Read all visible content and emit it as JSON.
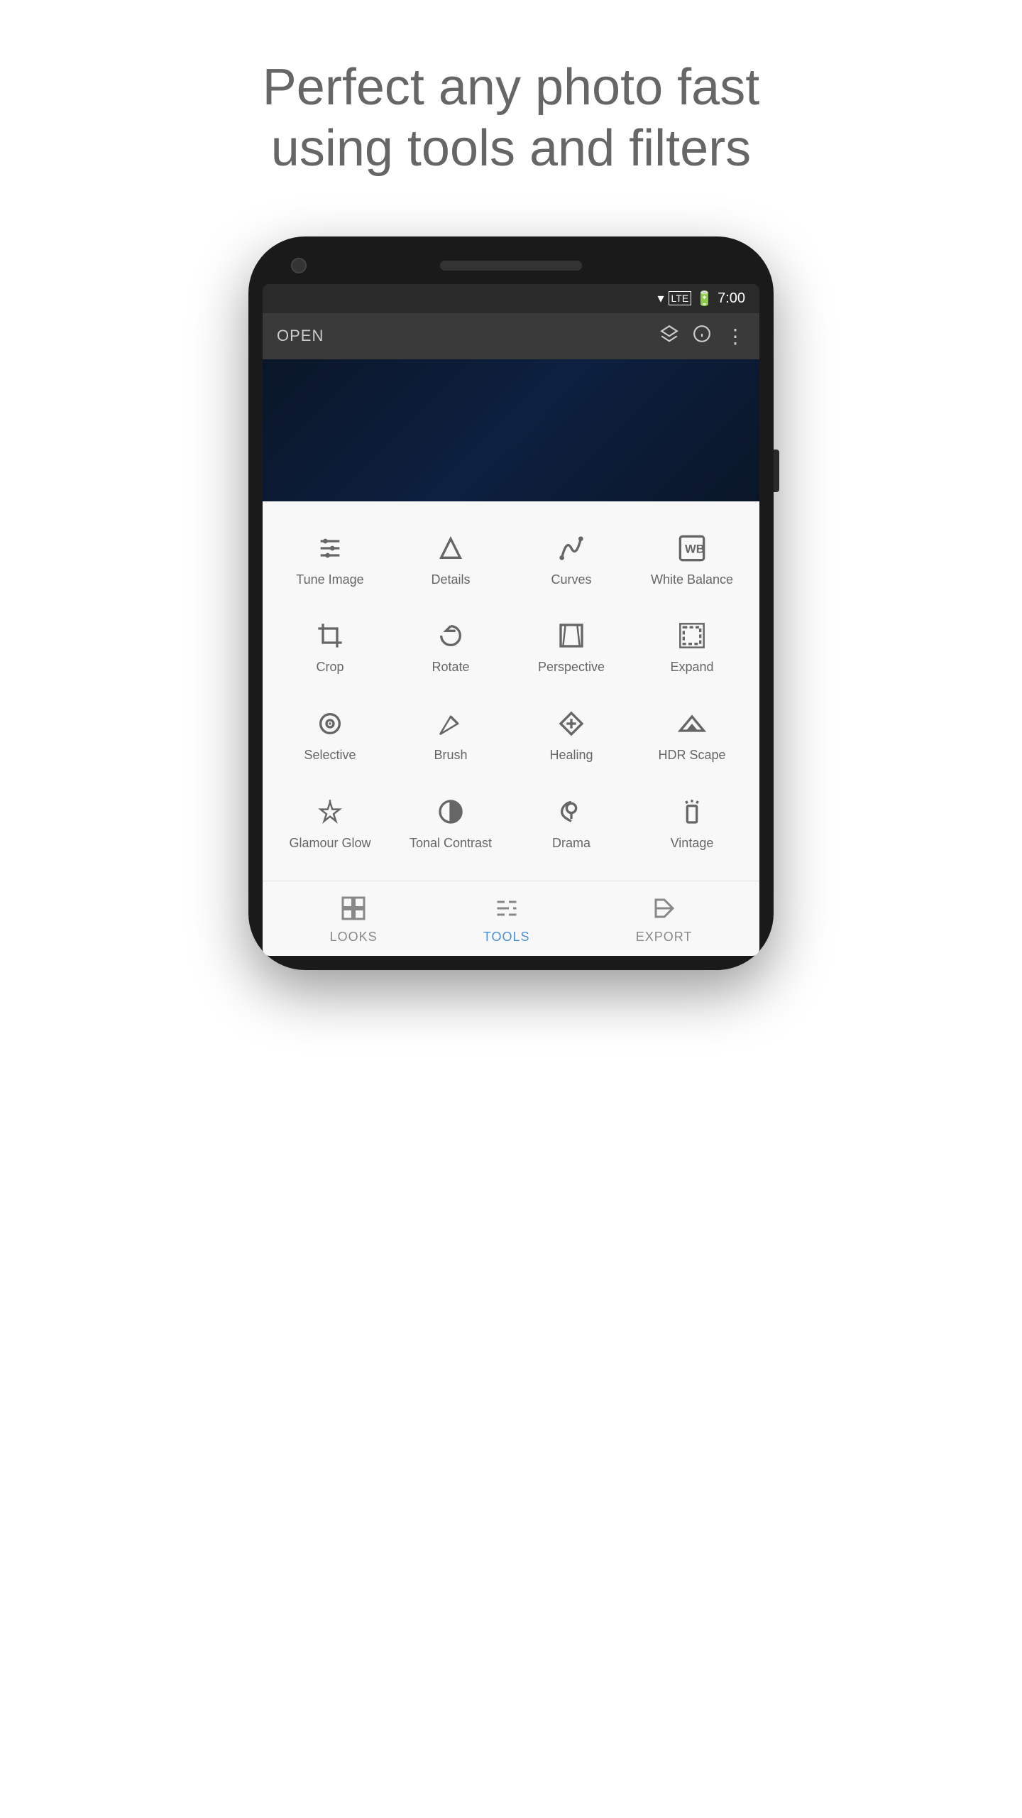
{
  "headline": {
    "line1": "Perfect any photo fast",
    "line2": "using tools and filters"
  },
  "statusBar": {
    "time": "7:00"
  },
  "toolbar": {
    "openLabel": "OPEN"
  },
  "tools": [
    {
      "id": "tune-image",
      "label": "Tune Image",
      "icon": "tune"
    },
    {
      "id": "details",
      "label": "Details",
      "icon": "details"
    },
    {
      "id": "curves",
      "label": "Curves",
      "icon": "curves"
    },
    {
      "id": "white-balance",
      "label": "White Balance",
      "icon": "wb"
    },
    {
      "id": "crop",
      "label": "Crop",
      "icon": "crop"
    },
    {
      "id": "rotate",
      "label": "Rotate",
      "icon": "rotate"
    },
    {
      "id": "perspective",
      "label": "Perspective",
      "icon": "perspective"
    },
    {
      "id": "expand",
      "label": "Expand",
      "icon": "expand"
    },
    {
      "id": "selective",
      "label": "Selective",
      "icon": "selective"
    },
    {
      "id": "brush",
      "label": "Brush",
      "icon": "brush"
    },
    {
      "id": "healing",
      "label": "Healing",
      "icon": "healing"
    },
    {
      "id": "hdr-scape",
      "label": "HDR Scape",
      "icon": "hdr"
    },
    {
      "id": "glamour-glow",
      "label": "Glamour Glow",
      "icon": "glamour"
    },
    {
      "id": "tonal-contrast",
      "label": "Tonal Contrast",
      "icon": "tonal"
    },
    {
      "id": "drama",
      "label": "Drama",
      "icon": "drama"
    },
    {
      "id": "vintage",
      "label": "Vintage",
      "icon": "vintage"
    }
  ],
  "bottomNav": [
    {
      "id": "looks",
      "label": "LOOKS",
      "active": false
    },
    {
      "id": "tools",
      "label": "TOOLS",
      "active": true
    },
    {
      "id": "export",
      "label": "EXPORT",
      "active": false
    }
  ]
}
